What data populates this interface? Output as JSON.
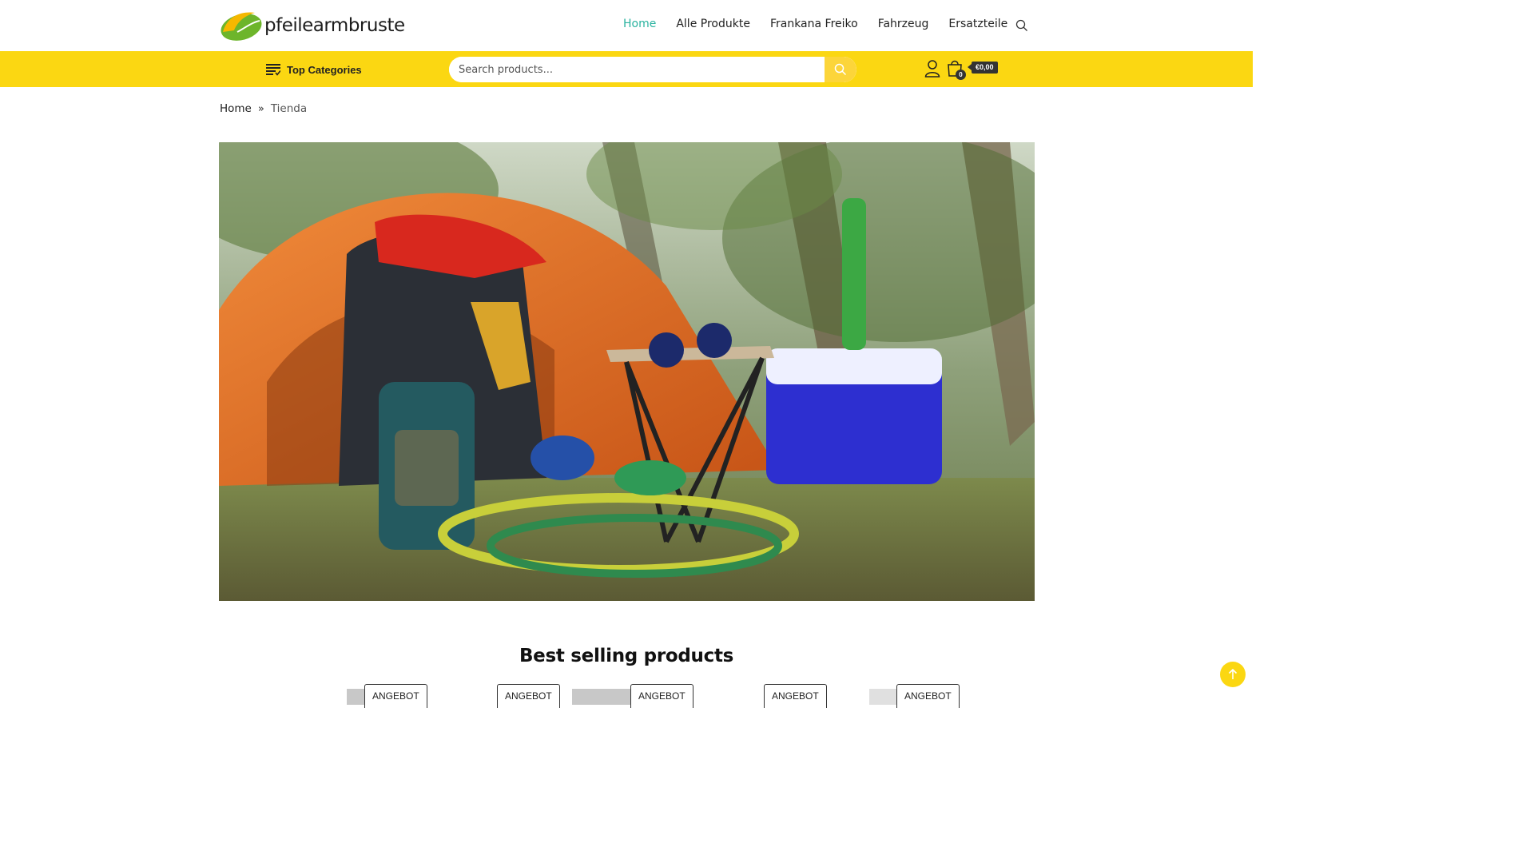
{
  "brand": {
    "name": "pfeilearmbruste"
  },
  "nav": {
    "items": [
      {
        "label": "Home",
        "active": true
      },
      {
        "label": "Alle Produkte",
        "active": false
      },
      {
        "label": "Frankana Freiko",
        "active": false
      },
      {
        "label": "Fahrzeug",
        "active": false
      },
      {
        "label": "Ersatzteile",
        "active": false
      }
    ]
  },
  "toolbar": {
    "top_categories": "Top Categories",
    "search_placeholder": "Search products...",
    "cart_count": "0",
    "cart_total": "€0,00"
  },
  "breadcrumb": {
    "home": "Home",
    "current": "Tienda"
  },
  "section": {
    "title": "Best selling products"
  },
  "products": [
    {
      "badge": "ANGEBOT"
    },
    {
      "badge": "ANGEBOT"
    },
    {
      "badge": "ANGEBOT"
    },
    {
      "badge": "ANGEBOT"
    },
    {
      "badge": "ANGEBOT"
    }
  ],
  "colors": {
    "accent_yellow": "#fbd712",
    "nav_active": "#2bb3a0",
    "logo_green": "#6db52b",
    "logo_yellow": "#f5b800"
  },
  "icons": [
    "search-icon",
    "menu-lines-icon",
    "user-icon",
    "cart-bag-icon",
    "arrow-up-icon"
  ]
}
